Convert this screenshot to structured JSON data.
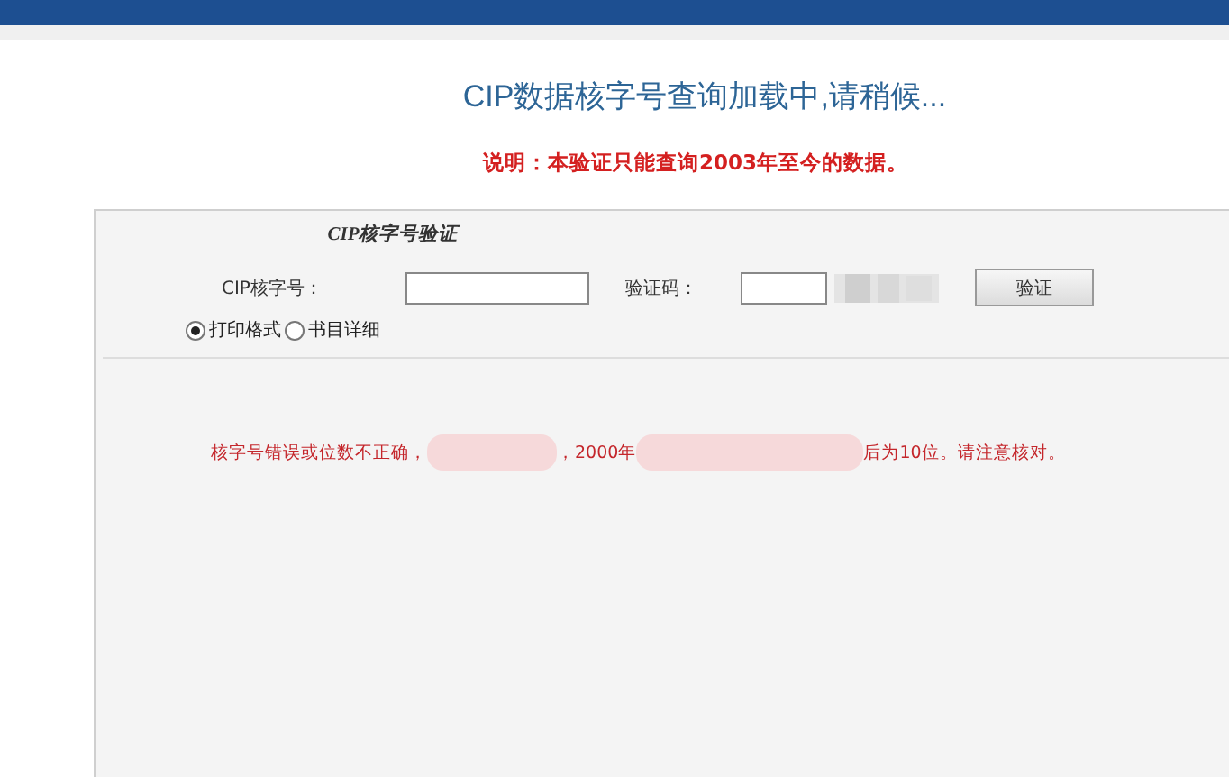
{
  "header": {
    "title": "CIP数据核字号查询加载中,请稍候..."
  },
  "notice": "说明：本验证只能查询2003年至今的数据。",
  "panel": {
    "title": "CIP核字号验证",
    "fields": [
      {
        "label": "CIP核字号：",
        "kind": "text"
      },
      {
        "label": "验证码：",
        "kind": "captcha"
      }
    ],
    "submit": "验证",
    "formats": [
      {
        "label": "打印格式",
        "selected": true
      },
      {
        "label": "书目详细",
        "selected": false
      }
    ],
    "error_parts": [
      {
        "kind": "text",
        "text": "核字号错误或位数不正确，"
      },
      {
        "kind": "redacted"
      },
      {
        "kind": "text",
        "text": "，2000年"
      },
      {
        "kind": "redacted"
      },
      {
        "kind": "text",
        "text": "后为10位。请注意核对。"
      }
    ]
  }
}
